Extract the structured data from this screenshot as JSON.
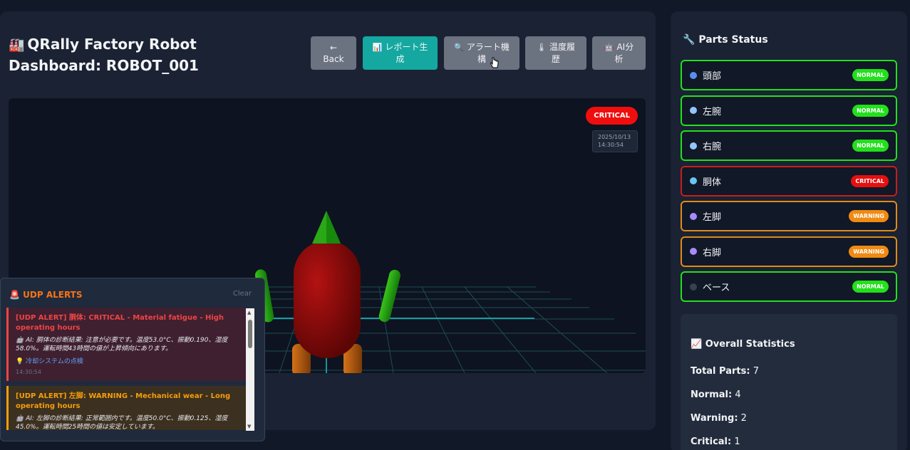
{
  "header": {
    "title_icon": "factory-emoji",
    "title": "QRally Factory Robot Dashboard: ROBOT_001"
  },
  "toolbar": {
    "back_icon": "←",
    "back_label": "Back",
    "report_label": "レポート生成",
    "alert_label": "アラート機構",
    "temp_label": "温度履歴",
    "ai_label": "AI分析"
  },
  "viewport": {
    "status_badge": "CRITICAL",
    "status_date": "2025/10/13",
    "status_time": "14:30:54"
  },
  "alerts": {
    "title": "UDP ALERTS",
    "clear_label": "Clear",
    "items": [
      {
        "title": "[UDP ALERT] 胴体: CRITICAL - Material fatigue - High operating hours",
        "body": "AI: 胴体の診断結果: 注意が必要です。温度53.0°C、振動0.190、湿度58.0%。運転時間43時間の値が上昇傾向にあります。",
        "link": "冷却システムの点検",
        "time": "14:30:54"
      },
      {
        "title": "[UDP ALERT] 左脚: WARNING - Mechanical wear - Long operating hours",
        "body": "AI: 左脚の診断結果: 正常範囲内です。温度50.0°C、振動0.125、湿度45.0%。運転時間25時間の値は安定しています。"
      }
    ]
  },
  "parts": {
    "title": "Parts Status",
    "items": [
      {
        "name": "頭部",
        "status": "NORMAL",
        "dot_color": "#5b8def"
      },
      {
        "name": "左腕",
        "status": "NORMAL",
        "dot_color": "#93c5fd"
      },
      {
        "name": "右腕",
        "status": "NORMAL",
        "dot_color": "#93c5fd"
      },
      {
        "name": "胴体",
        "status": "CRITICAL",
        "dot_color": "#67c6f3"
      },
      {
        "name": "左脚",
        "status": "WARNING",
        "dot_color": "#a78bfa"
      },
      {
        "name": "右脚",
        "status": "WARNING",
        "dot_color": "#a78bfa"
      },
      {
        "name": "ベース",
        "status": "NORMAL",
        "dot_color": "#374151"
      }
    ]
  },
  "stats": {
    "title": "Overall Statistics",
    "total_label": "Total Parts:",
    "total": "7",
    "normal_label": "Normal:",
    "normal": "4",
    "warning_label": "Warning:",
    "warning": "2",
    "critical_label": "Critical:",
    "critical": "1"
  },
  "colors": {
    "accent_teal": "#14a8a0",
    "normal": "#22e01c",
    "warning": "#f08a12",
    "critical": "#e60f0f"
  }
}
